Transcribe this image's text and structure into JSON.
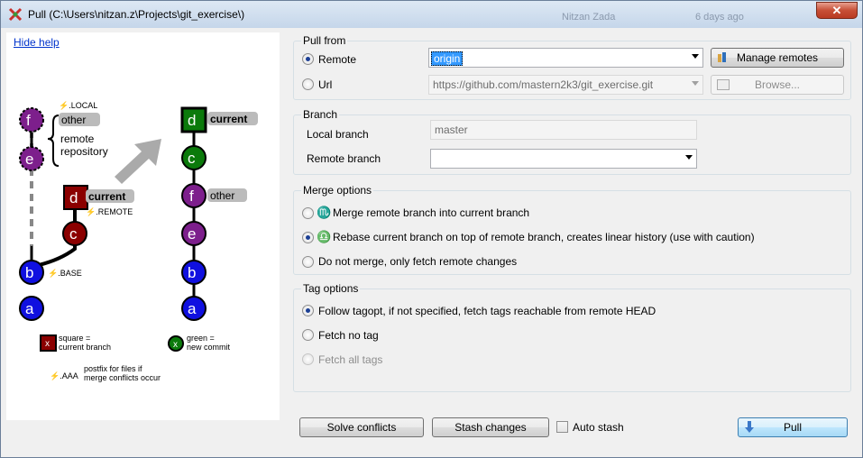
{
  "window": {
    "title": "Pull (C:\\Users\\nitzan.z\\Projects\\git_exercise\\)",
    "close_label": "✕",
    "ghost": [
      "Nitzan Zada",
      "6 days ago"
    ]
  },
  "help": {
    "hide_label": "Hide help",
    "diagram": {
      "local_tag": "⚡.LOCAL",
      "other_label": "other",
      "remote_repo": "remote repository",
      "remote_tag": "⚡.REMOTE",
      "base_tag": "⚡.BASE",
      "current_label": "current",
      "other_label2": "other",
      "current_label2": "current",
      "nodes_left": [
        "f",
        "e",
        "d",
        "c",
        "b",
        "a"
      ],
      "nodes_right": [
        "d",
        "c",
        "f",
        "e",
        "b",
        "a"
      ],
      "legend": {
        "x": "x",
        "square_text": "square = current branch",
        "green_text": "green = new commit",
        "aaa_tag": "⚡.AAA",
        "aaa_text": "postfix for files if merge conflicts occur"
      }
    }
  },
  "pull_from": {
    "title": "Pull from",
    "remote_label": "Remote",
    "remote_value": "origin",
    "url_label": "Url",
    "url_value": "https://github.com/mastern2k3/git_exercise.git",
    "manage_remotes": "Manage remotes",
    "browse": "Browse..."
  },
  "branch": {
    "title": "Branch",
    "local_label": "Local branch",
    "local_value": "master",
    "remote_label": "Remote branch",
    "remote_value": ""
  },
  "merge": {
    "title": "Merge options",
    "opt1": "Merge remote branch into current branch",
    "opt2": "Rebase current branch on top of remote branch, creates linear history (use with caution)",
    "opt3": "Do not merge, only fetch remote changes",
    "selected": 2
  },
  "tags": {
    "title": "Tag options",
    "opt1": "Follow tagopt, if not specified, fetch tags reachable from remote HEAD",
    "opt2": "Fetch no tag",
    "opt3": "Fetch all tags",
    "selected": 1
  },
  "footer": {
    "solve": "Solve conflicts",
    "stash": "Stash changes",
    "auto_stash": "Auto stash",
    "pull": "Pull"
  },
  "colors": {
    "purple": "#7d1f8c",
    "green": "#0b7a0b",
    "blue": "#1010e0",
    "darkred": "#8b0000",
    "accent": "#3c7fb1"
  }
}
